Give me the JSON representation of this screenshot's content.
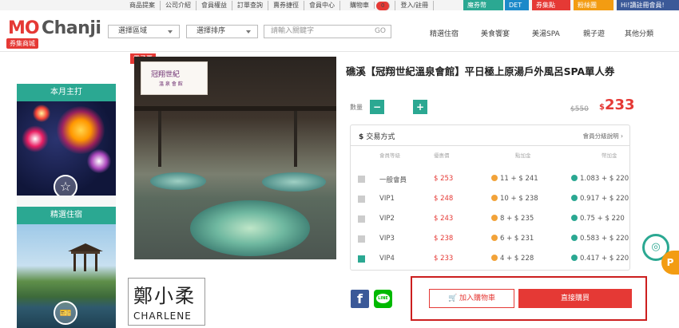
{
  "topbar": {
    "links": [
      "商品提案",
      "公司介紹",
      "會員權益",
      "訂單查詢",
      "賣券捷徑",
      "會員中心",
      "購物車",
      "登入/註冊"
    ],
    "cart_count": "0",
    "promos": [
      {
        "label": "魔券幣",
        "color": "#2ba892"
      },
      {
        "label": "DET",
        "color": "#1c89c9"
      },
      {
        "label": "券集點",
        "color": "#e53935"
      },
      {
        "label": "粉絲團",
        "color": "#f39c12"
      },
      {
        "label": "Hi!讀註冊會員!",
        "color": "#3b5998"
      }
    ]
  },
  "header": {
    "logo_mo": "MO",
    "logo_chanji": "Chanji",
    "logo_tag": "券集商城",
    "region_select": "選擇區域",
    "sort_select": "選擇排序",
    "search_placeholder": "請輸入關鍵字",
    "search_go": "GO",
    "categories": [
      "精選住宿",
      "美食饗宴",
      "美湯SPA",
      "親子遊",
      "其他分類"
    ]
  },
  "leftnav": {
    "box1_title": "本月主打",
    "box2_title": "精選住宿"
  },
  "product": {
    "eticket_label": "電子票",
    "hotel_sign_main": "冠翔世紀",
    "hotel_sign_sub": "溫 泉 會 館",
    "title": "礁溪【冠翔世紀溫泉會館】平日極上原湯戶外風呂SPA單人券",
    "qty_label": "數量",
    "qty_minus": "−",
    "qty_value": "1",
    "qty_plus": "+",
    "old_price": "$550",
    "new_price_symbol": "$",
    "new_price": "233"
  },
  "transaction": {
    "title": "交易方式",
    "link": "會員分級說明",
    "columns": [
      "會員等級",
      "優惠價",
      "點加金",
      "幣加金"
    ],
    "rows": [
      {
        "level": "一般會員",
        "price": "$ 253",
        "points": "11 + $ 241",
        "coins": "1.083 + $ 220",
        "selected": false
      },
      {
        "level": "VIP1",
        "price": "$ 248",
        "points": "10 + $ 238",
        "coins": "0.917 + $ 220",
        "selected": false
      },
      {
        "level": "VIP2",
        "price": "$ 243",
        "points": "8 + $ 235",
        "coins": "0.75 + $ 220",
        "selected": false
      },
      {
        "level": "VIP3",
        "price": "$ 238",
        "points": "6 + $ 231",
        "coins": "0.583 + $ 220",
        "selected": false
      },
      {
        "level": "VIP4",
        "price": "$ 233",
        "points": "4 + $ 228",
        "coins": "0.417 + $ 220",
        "selected": true
      }
    ]
  },
  "actions": {
    "add_to_cart": "加入購物車",
    "buy_now": "直接購買"
  },
  "watermark": {
    "name_cn": "鄭小柔",
    "name_en": "CHARLENE"
  },
  "floating": {
    "icon1": "◎",
    "icon2": "P"
  }
}
